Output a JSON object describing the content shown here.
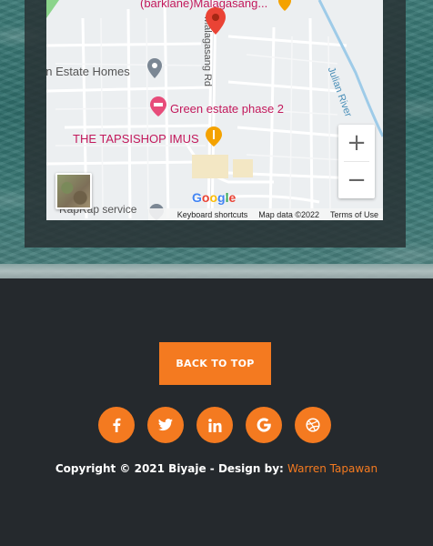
{
  "map": {
    "labels": {
      "barklane": "(barklane)Malagasang...",
      "green_estate_homes": "en Estate Homes",
      "street": "Malagasang Rd",
      "river": "Julian River",
      "green_estate_phase": "Green estate phase 2",
      "tapsishop": "THE TAPSISHOP IMUS",
      "rapkap": "RapRap service"
    },
    "zoom_in": "+",
    "zoom_out": "−",
    "google_logo": "Google",
    "attribution": {
      "shortcuts": "Keyboard shortcuts",
      "data": "Map data ©2022",
      "terms": "Terms of Use"
    }
  },
  "footer": {
    "back_to_top": "BACK TO TOP",
    "socials": [
      {
        "name": "facebook",
        "icon": "facebook-icon"
      },
      {
        "name": "twitter",
        "icon": "twitter-icon"
      },
      {
        "name": "linkedin",
        "icon": "linkedin-icon"
      },
      {
        "name": "google",
        "icon": "google-icon"
      },
      {
        "name": "dribbble",
        "icon": "dribbble-icon"
      }
    ],
    "copyright_prefix": "Copyright © 2021 Biyaje - Design by:",
    "copyright_author": "Warren Tapawan"
  },
  "colors": {
    "accent": "#f47a20",
    "footer_bg": "#25292d",
    "poi_text": "#c2185b"
  }
}
